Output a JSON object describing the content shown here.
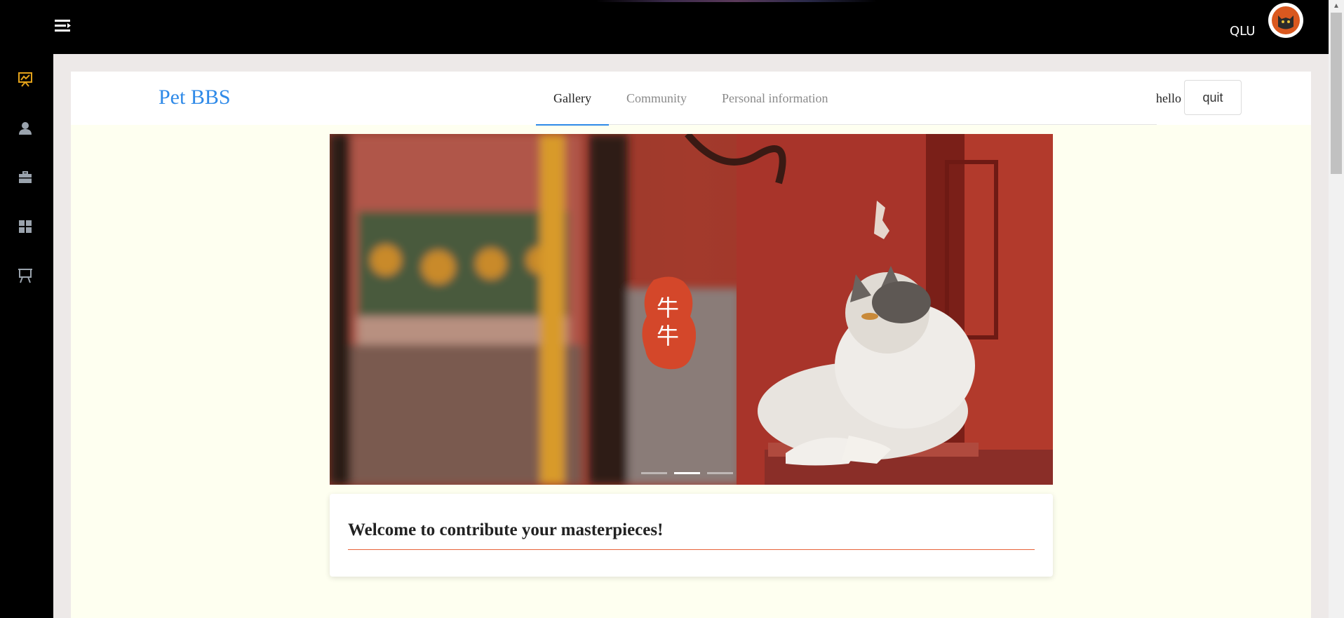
{
  "topbar": {
    "user_name": "QLU",
    "menu_icon": "menu-toggle-icon",
    "avatar_icon": "cat-avatar-icon"
  },
  "sidebar": {
    "items": [
      {
        "icon": "presentation-chart-icon",
        "active": true
      },
      {
        "icon": "user-icon"
      },
      {
        "icon": "briefcase-icon"
      },
      {
        "icon": "grid-icon"
      },
      {
        "icon": "easel-icon"
      }
    ],
    "active_color": "#e3a21a"
  },
  "header": {
    "brand": "Pet BBS",
    "tabs": [
      {
        "label": "Gallery",
        "active": true
      },
      {
        "label": "Community"
      },
      {
        "label": "Personal information"
      }
    ],
    "greeting": "hello",
    "quit_label": "quit",
    "accent": "#2f8ae8"
  },
  "carousel": {
    "seal_text": [
      "牛",
      "牛"
    ],
    "slide_count": 3,
    "active_slide": 2
  },
  "welcome": {
    "title": "Welcome to contribute your masterpieces!",
    "underline_color": "#e8643a"
  }
}
